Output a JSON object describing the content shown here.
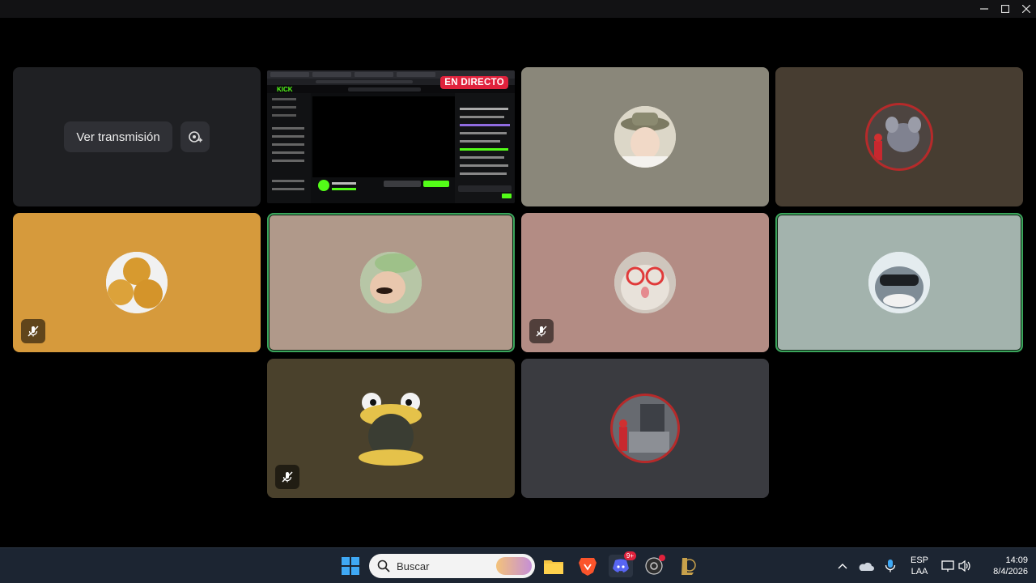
{
  "window": {
    "minimize_icon": "minimize-icon",
    "maximize_icon": "maximize-icon",
    "close_icon": "close-icon"
  },
  "stream_tile": {
    "watch_label": "Ver transmisión",
    "popout_icon": "add-view-icon",
    "live_badge": "EN DIRECTO"
  },
  "tiles": [
    {
      "bg": "#8a877a",
      "speaking": false,
      "muted": false,
      "avatar": "hat-person-avatar"
    },
    {
      "bg": "#473d31",
      "speaking": false,
      "muted": false,
      "avatar": "rat-avatar"
    },
    {
      "bg": "#d69a3c",
      "speaking": false,
      "muted": true,
      "avatar": "food-avatar"
    },
    {
      "bg": "#b0998a",
      "speaking": true,
      "muted": false,
      "avatar": "cap-person-avatar"
    },
    {
      "bg": "#b38c84",
      "speaking": false,
      "muted": true,
      "avatar": "cat-glasses-avatar"
    },
    {
      "bg": "#a3b3ad",
      "speaking": true,
      "muted": false,
      "avatar": "shark-avatar"
    },
    {
      "bg": "#4a412c",
      "speaking": false,
      "muted": true,
      "avatar": "frog-hat-avatar"
    },
    {
      "bg": "#3a3b40",
      "speaking": false,
      "muted": false,
      "avatar": "room-avatar"
    }
  ],
  "taskbar": {
    "search_placeholder": "Buscar",
    "discord_badge": "9+",
    "lang_top": "ESP",
    "lang_bottom": "LAA",
    "time": "14:09",
    "date": "8/4/2026"
  },
  "colors": {
    "speaking": "#3ba55c",
    "live": "#e0223c",
    "kick_green": "#53fc18"
  }
}
